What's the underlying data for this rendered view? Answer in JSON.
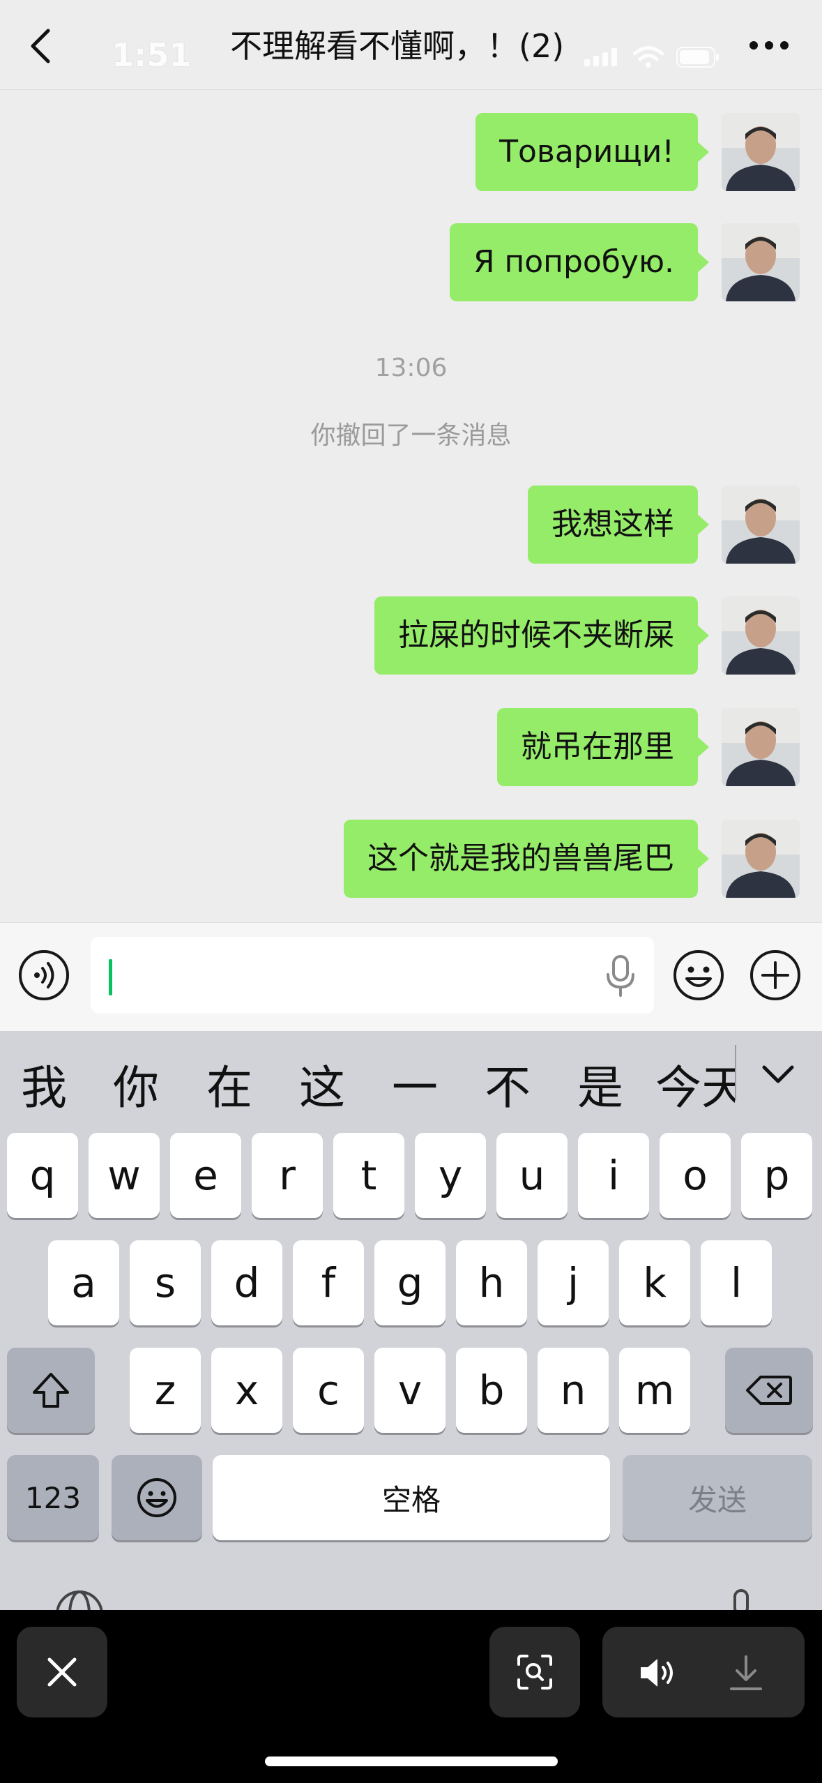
{
  "header": {
    "title": "不理解看不懂啊，！(2)",
    "status_time": "1:51",
    "icons": {
      "back": "chevron-left-icon",
      "more": "more-dots-icon"
    }
  },
  "chat": {
    "messages": [
      {
        "text": "Товарищи!",
        "sender": "me"
      },
      {
        "text": "Я попробую.",
        "sender": "me"
      },
      {
        "text": "我想这样",
        "sender": "me"
      },
      {
        "text": "拉屎的时候不夹断屎",
        "sender": "me"
      },
      {
        "text": "就吊在那里",
        "sender": "me"
      },
      {
        "text": "这个就是我的兽兽尾巴",
        "sender": "me"
      }
    ],
    "timestamp": "13:06",
    "system_message": "你撤回了一条消息"
  },
  "input_bar": {
    "value": "",
    "icons": {
      "voice": "voice-toggle-icon",
      "mic": "microphone-icon",
      "emoji": "emoji-icon",
      "plus": "plus-icon"
    }
  },
  "keyboard": {
    "candidates": [
      "我",
      "你",
      "在",
      "这",
      "一",
      "不",
      "是",
      "今天"
    ],
    "row1": [
      "q",
      "w",
      "e",
      "r",
      "t",
      "y",
      "u",
      "i",
      "o",
      "p"
    ],
    "row2": [
      "a",
      "s",
      "d",
      "f",
      "g",
      "h",
      "j",
      "k",
      "l"
    ],
    "row3": [
      "z",
      "x",
      "c",
      "v",
      "b",
      "n",
      "m"
    ],
    "numbers_label": "123",
    "space_label": "空格",
    "send_label": "发送"
  },
  "viewer_bar": {
    "icons": {
      "close": "close-icon",
      "scan": "scan-icon",
      "sound": "speaker-icon",
      "download": "download-icon"
    }
  },
  "colors": {
    "bubble": "#95ec69",
    "background": "#ededed",
    "caret": "#07c160",
    "keyboard": "#d1d3d9"
  }
}
